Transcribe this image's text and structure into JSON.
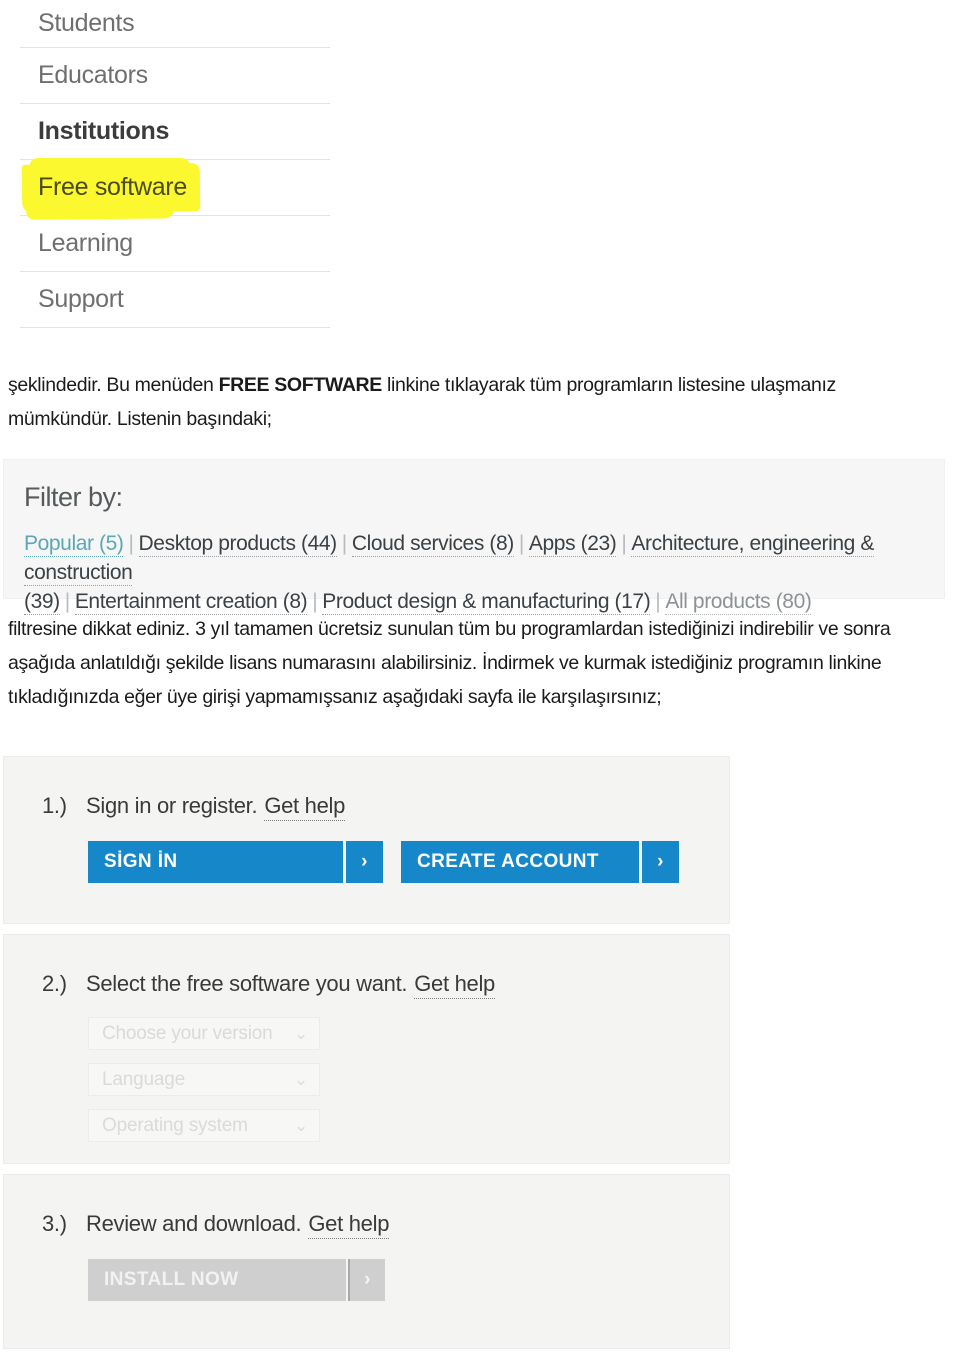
{
  "menu": {
    "items": [
      {
        "label": "Students",
        "style": "normal"
      },
      {
        "label": "Educators",
        "style": "normal"
      },
      {
        "label": "Institutions",
        "style": "bold"
      },
      {
        "label": "Free software",
        "style": "highlighted"
      },
      {
        "label": "Learning",
        "style": "normal"
      },
      {
        "label": "Support",
        "style": "normal"
      }
    ],
    "highlight_color": "#fbf830"
  },
  "paragraphs": {
    "p1_before": "şeklindedir. Bu menüden ",
    "p1_bold": "FREE SOFTWARE",
    "p1_after": " linkine tıklayarak tüm programların listesine ulaşmanız mümkündür. Listenin başındaki;",
    "p2": "filtresine dikkat ediniz. 3 yıl tamamen ücretsiz sunulan tüm bu programlardan istediğinizi indirebilir ve sonra aşağıda anlatıldığı şekilde lisans numarasını alabilirsiniz. İndirmek ve kurmak istediğiniz programın linkine tıkladığınızda eğer üye girişi yapmamışsanız aşağıdaki sayfa ile karşılaşırsınız;"
  },
  "filter": {
    "title": "Filter by:",
    "active_color": "#5aa8b5",
    "links": [
      {
        "label": "Popular (5)",
        "state": "active"
      },
      {
        "label": "Desktop products (44)",
        "state": "normal"
      },
      {
        "label": "Cloud services (8)",
        "state": "normal"
      },
      {
        "label": "Apps (23)",
        "state": "normal"
      },
      {
        "label": "Architecture, engineering & construction (39)",
        "state": "normal"
      },
      {
        "label": "Entertainment creation (8)",
        "state": "normal"
      },
      {
        "label": "Product design & manufacturing (17)",
        "state": "normal"
      },
      {
        "label": "All products (80)",
        "state": "muted"
      }
    ],
    "separator": "|"
  },
  "steps": {
    "step1": {
      "number": "1.)",
      "text": "Sign in or register.",
      "help": "Get help",
      "buttons": [
        {
          "label": "SİGN İN",
          "arrow": "›",
          "color": "#1688c9",
          "disabled": false
        },
        {
          "label": "CREATE ACCOUNT",
          "arrow": "›",
          "color": "#1688c9",
          "disabled": false
        }
      ]
    },
    "step2": {
      "number": "2.)",
      "text": "Select the free software you want.",
      "help": "Get help",
      "selects": [
        {
          "placeholder": "Choose your version",
          "chevron": "⌄"
        },
        {
          "placeholder": "Language",
          "chevron": "⌄"
        },
        {
          "placeholder": "Operating system",
          "chevron": "⌄"
        }
      ]
    },
    "step3": {
      "number": "3.)",
      "text": "Review and download.",
      "help": "Get help",
      "buttons": [
        {
          "label": "INSTALL NOW",
          "arrow": "›",
          "color": "#cfcfcf",
          "disabled": true
        }
      ]
    }
  }
}
